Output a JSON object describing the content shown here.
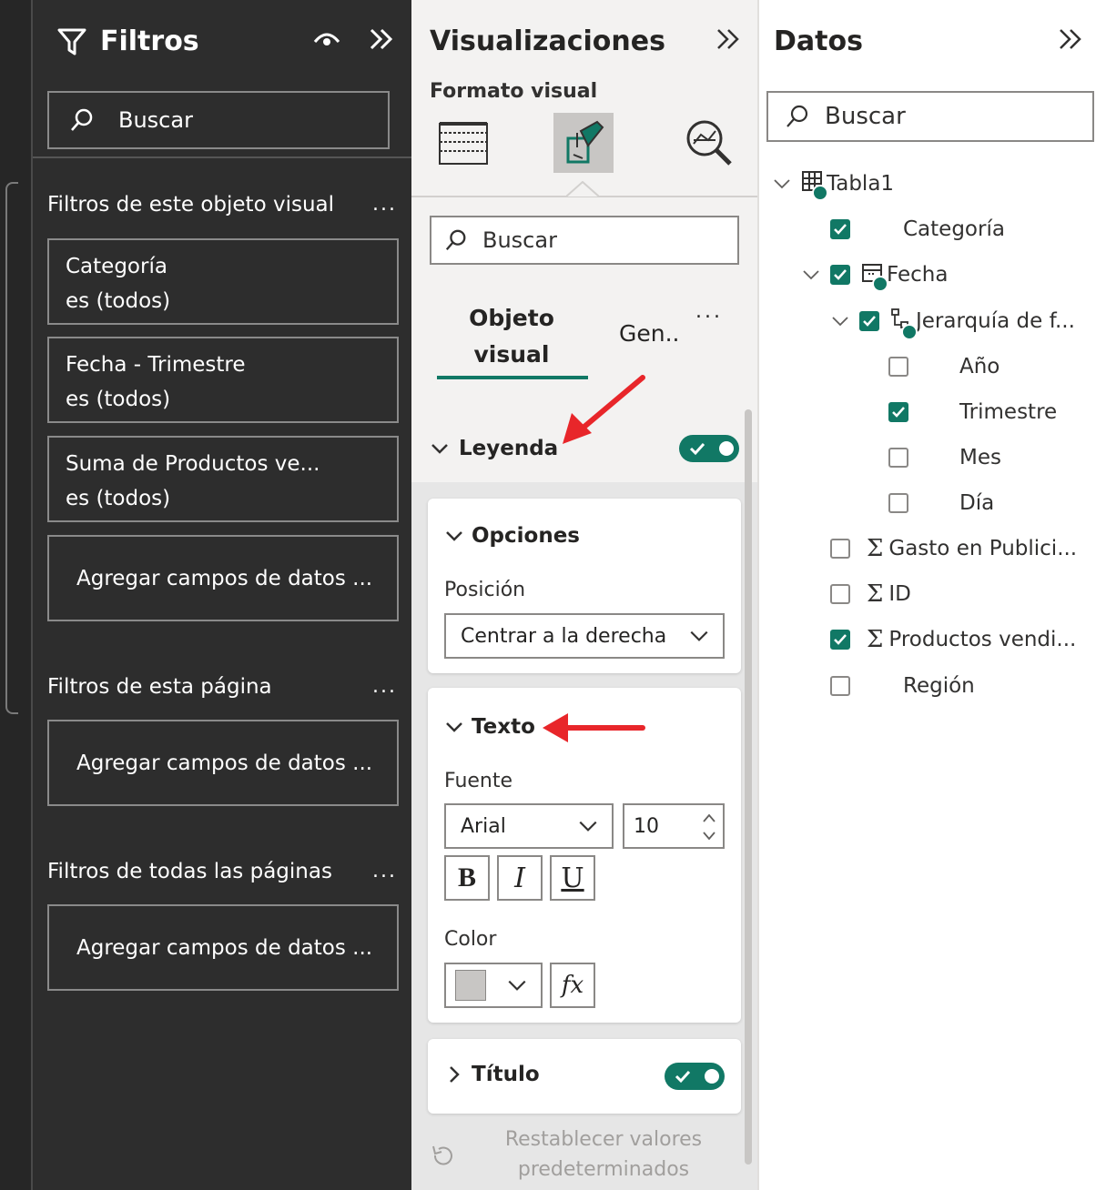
{
  "filters": {
    "title": "Filtros",
    "search_placeholder": "Buscar",
    "visual_section": "Filtros de este objeto visual",
    "visual_cards": [
      {
        "field": "Categoría",
        "state": "es (todos)"
      },
      {
        "field": "Fecha - Trimestre",
        "state": "es (todos)"
      },
      {
        "field": "Suma de Productos ve...",
        "state": "es (todos)"
      }
    ],
    "add_fields": "Agregar campos de datos ...",
    "page_section": "Filtros de esta página",
    "all_pages_section": "Filtros de todas las páginas",
    "more": "..."
  },
  "viz": {
    "title": "Visualizaciones",
    "subtitle": "Formato visual",
    "search_placeholder": "Buscar",
    "tab_visual_line1": "Objeto",
    "tab_visual_line2": "visual",
    "tab_general": "Gen..",
    "more": "...",
    "legend": {
      "label": "Leyenda",
      "enabled": true
    },
    "options": {
      "label": "Opciones",
      "position_label": "Posición",
      "position_value": "Centrar a la derecha"
    },
    "text": {
      "label": "Texto",
      "font_label": "Fuente",
      "font_value": "Arial",
      "size_value": "10",
      "bold": "B",
      "italic": "I",
      "underline": "U",
      "color_label": "Color",
      "color_value": "#c8c6c4",
      "fx": "fx"
    },
    "title_section": {
      "label": "Título",
      "enabled": true
    },
    "reset": "Restablecer valores predeterminados"
  },
  "data": {
    "title": "Datos",
    "search_placeholder": "Buscar",
    "table": "Tabla1",
    "fields": {
      "categoria": "Categoría",
      "fecha": "Fecha",
      "jerarquia": "Jerarquía de f...",
      "anio": "Año",
      "trimestre": "Trimestre",
      "mes": "Mes",
      "dia": "Día",
      "gasto": "Gasto en Publici...",
      "id": "ID",
      "productos": "Productos vendi...",
      "region": "Región"
    }
  },
  "colors": {
    "accent": "#117865",
    "annotation": "#e8262a",
    "filters_bg": "#2d2d2d",
    "viz_bg": "#f3f2f1"
  }
}
